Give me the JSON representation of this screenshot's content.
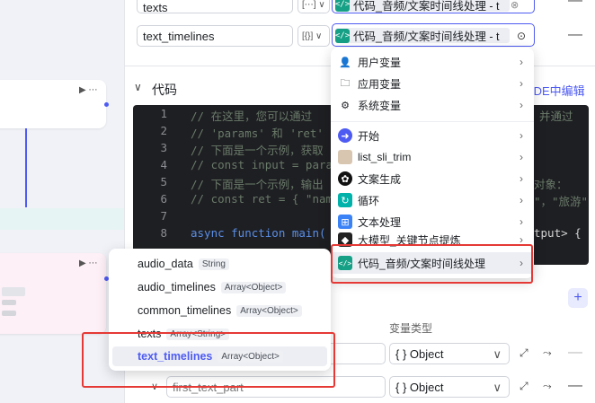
{
  "outputs": {
    "rows": [
      {
        "name": "texts",
        "type_badge": "[⋯]",
        "ref_label": "代码_音频/文案时间线处理 - t"
      },
      {
        "name": "text_timelines",
        "type_badge": "[{}]",
        "ref_label": "代码_音频/文案时间线处理 - t"
      }
    ]
  },
  "code_section": {
    "title": "代码",
    "ide_button": "IDE中编辑",
    "lines": [
      {
        "n": "1",
        "text": "// 在这里，您可以通过"
      },
      {
        "n": "2",
        "text": "// 'params' 和 'ret'"
      },
      {
        "n": "3",
        "text": "// 下面是一个示例，获取"
      },
      {
        "n": "4",
        "text": "// const input = para"
      },
      {
        "n": "5",
        "text": "// 下面是一个示例，输出"
      },
      {
        "n": "6",
        "text": "// const ret = { \"nam"
      },
      {
        "n": "7",
        "text": ""
      },
      {
        "n": "8",
        "text": "async function main("
      }
    ],
    "right_fragments": [
      "并通过",
      "对象：",
      "\"，\"旅游\"",
      "tput> {"
    ]
  },
  "menu_nodes": {
    "items": [
      {
        "label": "用户变量",
        "icon": "user-icon"
      },
      {
        "label": "应用变量",
        "icon": "folder-icon"
      },
      {
        "label": "系统变量",
        "icon": "gear-icon"
      },
      {
        "label": "开始",
        "icon": "start-icon",
        "color": "#4e5bf2"
      },
      {
        "label": "list_sli_trim",
        "icon": "avatar-image-icon"
      },
      {
        "label": "文案生成",
        "icon": "openai-icon"
      },
      {
        "label": "循环",
        "icon": "loop-icon",
        "color": "#00b2a9"
      },
      {
        "label": "文本处理",
        "icon": "text-process-icon",
        "color": "#3b82f6"
      },
      {
        "label": "大模型_关键节点提炼",
        "icon": "llm-icon"
      },
      {
        "label": "代码_音频/文案时间线处理",
        "icon": "code-icon",
        "color": "#16a085"
      }
    ]
  },
  "menu_vars": {
    "items": [
      {
        "name": "audio_data",
        "type": "String"
      },
      {
        "name": "audio_timelines",
        "type": "Array<Object>"
      },
      {
        "name": "common_timelines",
        "type": "Array<Object>"
      },
      {
        "name": "texts",
        "type": "Array<String>"
      },
      {
        "name": "text_timelines",
        "type": "Array<Object>"
      }
    ]
  },
  "output_vars": {
    "type_header": "变量类型",
    "rows": [
      {
        "name": "",
        "type": "{ } Object"
      },
      {
        "name": "first_text_part",
        "type": "{ } Object"
      }
    ]
  },
  "colors": {
    "accent": "#4e5bf2",
    "highlight_red": "#e53935",
    "code_bg": "#1e1f22"
  }
}
